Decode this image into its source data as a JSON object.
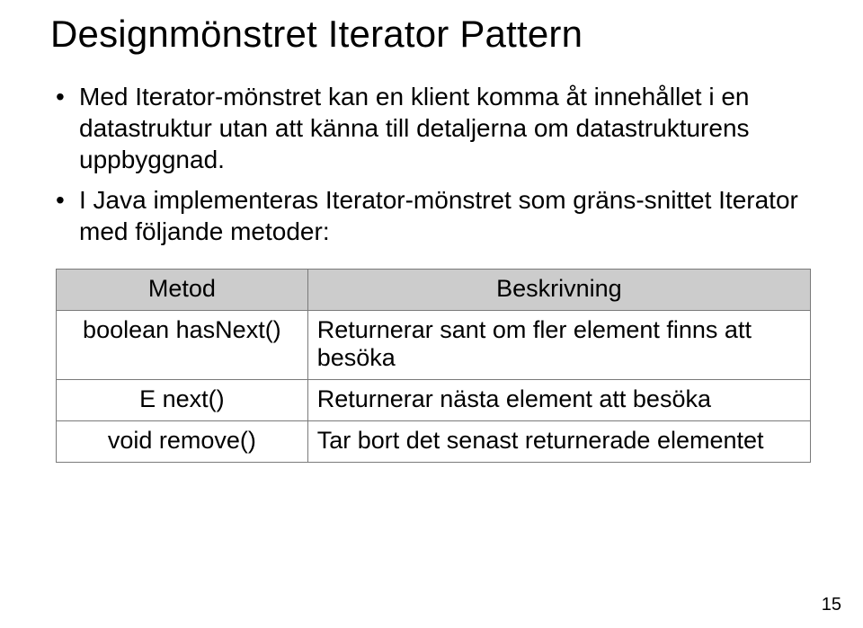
{
  "title": "Designmönstret Iterator Pattern",
  "bullets": {
    "b1": "Med Iterator-mönstret kan en klient komma åt innehållet i en datastruktur utan att känna till detaljerna om datastrukturens uppbyggnad.",
    "b2": "I Java implementeras Iterator-mönstret som gräns-snittet Iterator med följande metoder:"
  },
  "table": {
    "head_method": "Metod",
    "head_desc": "Beskrivning",
    "rows": {
      "r0": {
        "method": "boolean hasNext()",
        "desc": "Returnerar sant om fler element finns att besöka"
      },
      "r1": {
        "method": "E next()",
        "desc": "Returnerar nästa element att besöka"
      },
      "r2": {
        "method": "void remove()",
        "desc": "Tar bort det senast returnerade elementet"
      }
    }
  },
  "pagenum": "15"
}
